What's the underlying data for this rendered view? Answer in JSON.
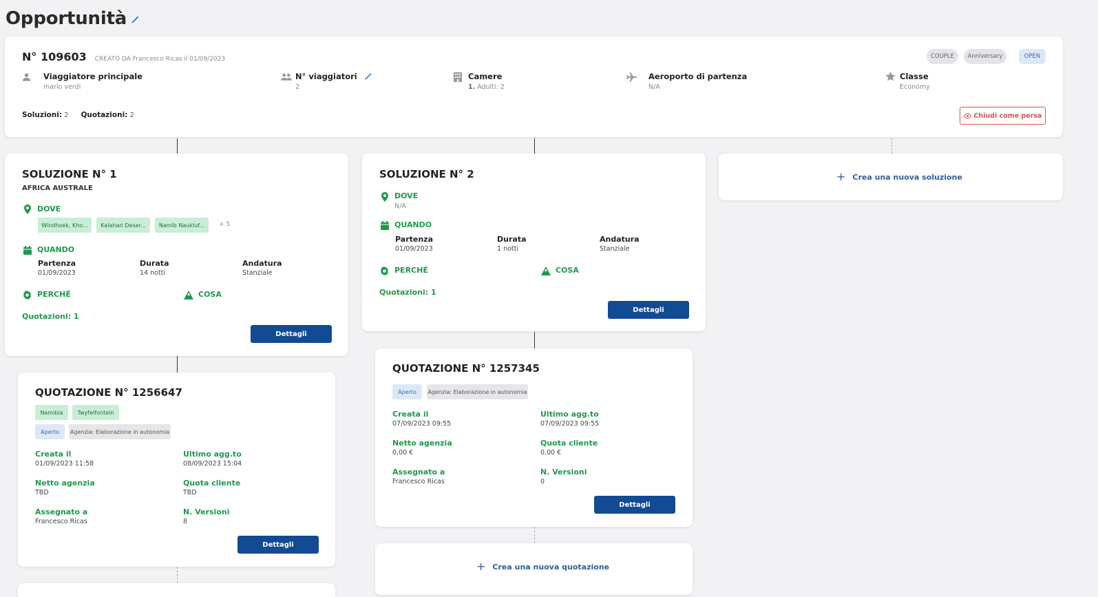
{
  "page": {
    "title": "Opportunità"
  },
  "opportunity": {
    "number": "N° 109603",
    "created": "CREATO DA Francesco Ricas il 01/09/2023",
    "pills": [
      "COUPLE",
      "Anniversary",
      "OPEN"
    ],
    "fields": [
      {
        "label": "Viaggiatore principale",
        "value": "mario verdi"
      },
      {
        "label": "N° viaggiatori",
        "value": "2"
      },
      {
        "label": "Camere",
        "value_bold": "1.",
        "value": "Adulti: 2"
      },
      {
        "label": "Aeroporto di partenza",
        "value": "N/A"
      },
      {
        "label": "Classe",
        "value": "Economy"
      }
    ],
    "soluzioni_label": "Soluzioni:",
    "soluzioni_value": "2",
    "quotazioni_label": "Quotazioni:",
    "quotazioni_value": "2",
    "close_label": "Chiudi come persa"
  },
  "solution1": {
    "title": "SOLUZIONE N° 1",
    "subtitle": "AFRICA AUSTRALE",
    "dove": "DOVE",
    "places": [
      "Windhoek, Kho...",
      "Kalahari Deser...",
      "Namib Naukluf..."
    ],
    "more": "+ 5",
    "quando": "QUANDO",
    "partenza_label": "Partenza",
    "partenza": "01/09/2023",
    "durata_label": "Durata",
    "durata": "14 notti",
    "andatura_label": "Andatura",
    "andatura": "Stanziale",
    "perche": "PERCHÉ",
    "cosa": "COSA",
    "quotazioni": "Quotazioni: 1",
    "button": "Dettagli"
  },
  "solution2": {
    "title": "SOLUZIONE N° 2",
    "dove": "DOVE",
    "dove_value": "N/A",
    "quando": "QUANDO",
    "partenza_label": "Partenza",
    "partenza": "01/09/2023",
    "durata_label": "Durata",
    "durata": "1 notti",
    "andatura_label": "Andatura",
    "andatura": "Stanziale",
    "perche": "PERCHÉ",
    "cosa": "COSA",
    "quotazioni": "Quotazioni: 1",
    "button": "Dettagli"
  },
  "new_solution": {
    "label": "Crea una nuova soluzione"
  },
  "quote1": {
    "title": "QUOTAZIONE N° 1256647",
    "tags": [
      "Namibia",
      "Twyfelfontein"
    ],
    "status": "Aperto",
    "agency": "Agenzia: Elaborazione in autonomia",
    "creata_label": "Creata il",
    "creata": "01/09/2023 11:58",
    "ultimo_label": "Ultimo agg.to",
    "ultimo": "08/09/2023 15:04",
    "netto_label": "Netto agenzia",
    "netto": "TBD",
    "quota_label": "Quota cliente",
    "quota": "TBD",
    "assegnato_label": "Assegnato a",
    "assegnato": "Francesco Ricas",
    "versioni_label": "N. Versioni",
    "versioni": "8",
    "button": "Dettagli"
  },
  "quote2": {
    "title": "QUOTAZIONE N° 1257345",
    "status": "Aperto",
    "agency": "Agenzia: Elaborazione in autonomia",
    "creata_label": "Creata il",
    "creata": "07/09/2023 09:55",
    "ultimo_label": "Ultimo agg.to",
    "ultimo": "07/09/2023 09:55",
    "netto_label": "Netto agenzia",
    "netto": "0,00 €",
    "quota_label": "Quota cliente",
    "quota": "0,00 €",
    "assegnato_label": "Assegnato a",
    "assegnato": "Francesco Ricas",
    "versioni_label": "N. Versioni",
    "versioni": "0",
    "button": "Dettagli"
  },
  "new_quote": {
    "label": "Crea una nuova quotazione"
  },
  "colors": {
    "primary": "#124b93",
    "green": "#1f9a4b",
    "danger": "#d9534f",
    "link": "#2e5d98"
  }
}
